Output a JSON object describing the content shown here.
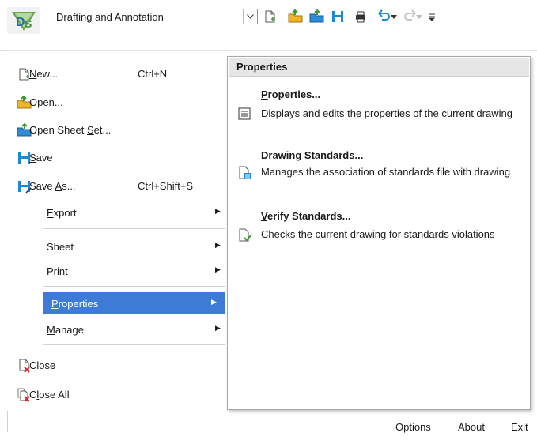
{
  "toolbar": {
    "workspace_value": "Drafting and Annotation",
    "icons": [
      "new-icon",
      "open-icon",
      "open-sheet-set-icon",
      "save-icon",
      "plot-icon",
      "undo-icon",
      "redo-icon",
      "customize-icon"
    ]
  },
  "menu": {
    "new": {
      "label_u": "N",
      "label_rest": "ew...",
      "shortcut": "Ctrl+N"
    },
    "open": {
      "label_u": "O",
      "label_rest": "pen..."
    },
    "open_sheet_set": {
      "label_pre": "Open Sheet ",
      "label_u": "S",
      "label_rest": "et..."
    },
    "save": {
      "label_u": "S",
      "label_rest": "ave"
    },
    "save_as": {
      "label_pre": "Save ",
      "label_u": "A",
      "label_rest": "s...",
      "shortcut": "Ctrl+Shift+S"
    },
    "export": {
      "label_u": "E",
      "label_rest": "xport"
    },
    "sheet": {
      "label": "Sheet"
    },
    "print": {
      "label_u": "P",
      "label_rest": "rint"
    },
    "properties": {
      "label_u": "P",
      "label_rest": "roperties"
    },
    "manage": {
      "label_u": "M",
      "label_rest": "anage"
    },
    "close": {
      "label_u": "C",
      "label_rest": "lose"
    },
    "close_all": {
      "label_pre": "C",
      "label_u": "l",
      "label_rest": "ose All"
    }
  },
  "submenu": {
    "header": "Properties",
    "items": [
      {
        "title_u": "P",
        "title_rest": "roperties...",
        "desc": "Displays and edits the properties of the current drawing"
      },
      {
        "title_pre": "Drawing ",
        "title_u": "S",
        "title_rest": "tandards...",
        "desc": "Manages the association of standards file with drawing"
      },
      {
        "title_u": "V",
        "title_rest": "erify Standards...",
        "desc": "Checks the current drawing for standards violations"
      }
    ]
  },
  "footer": {
    "options": "Options",
    "about": "About",
    "exit": "Exit"
  }
}
